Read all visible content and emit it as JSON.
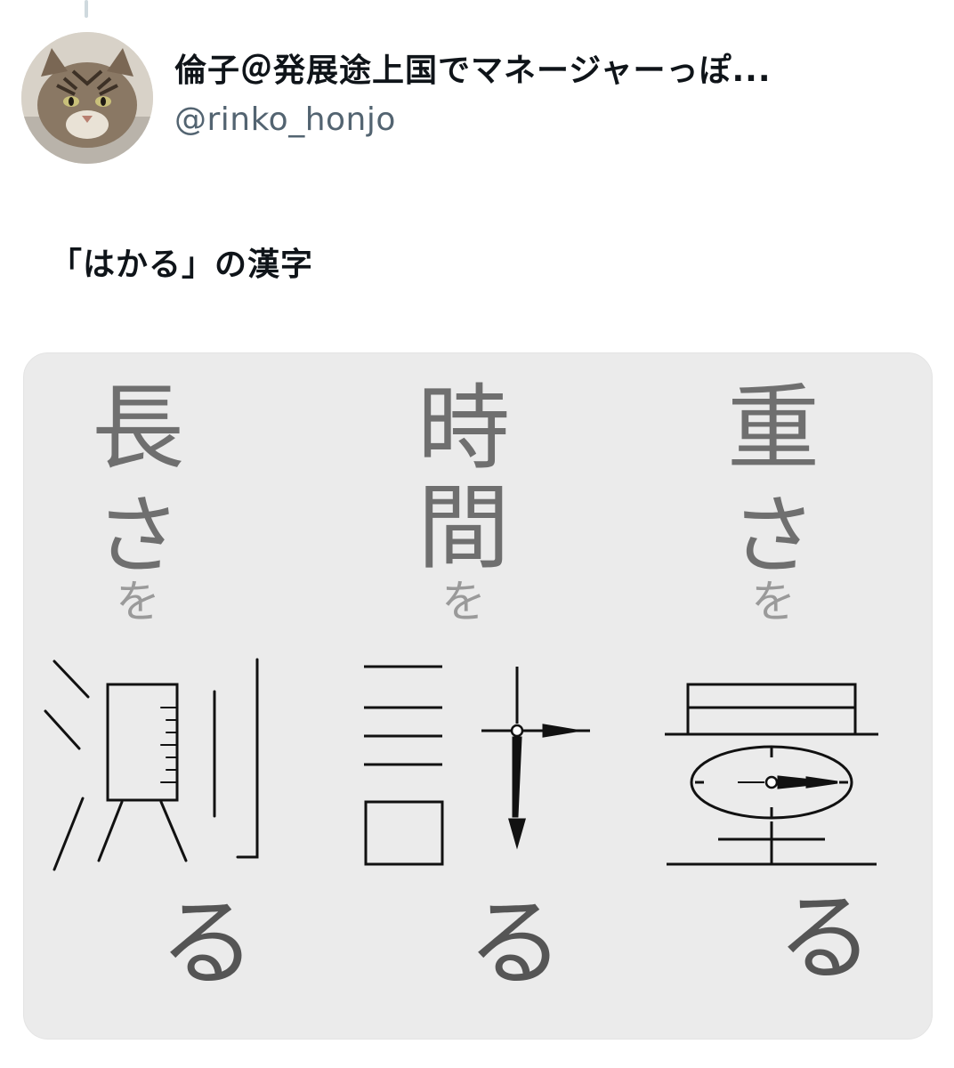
{
  "author": {
    "display_name": "倫子＠発展途上国でマネージャーっぽ...",
    "handle": "@rinko_honjo",
    "avatar_icon": "cat-avatar-icon"
  },
  "tweet": {
    "text": "「はかる」の漢字"
  },
  "media": {
    "columns": [
      {
        "top": [
          "長",
          "さ"
        ],
        "wo": "を",
        "ru": "る",
        "kanji": "測"
      },
      {
        "top": [
          "時",
          "間"
        ],
        "wo": "を",
        "ru": "る",
        "kanji": "計"
      },
      {
        "top": [
          "重",
          "さ"
        ],
        "wo": "を",
        "ru": "る",
        "kanji": "量"
      }
    ]
  },
  "colors": {
    "name": "#0f1419",
    "handle": "#536471",
    "card_bg": "#ebebeb",
    "ink": "#111111"
  }
}
